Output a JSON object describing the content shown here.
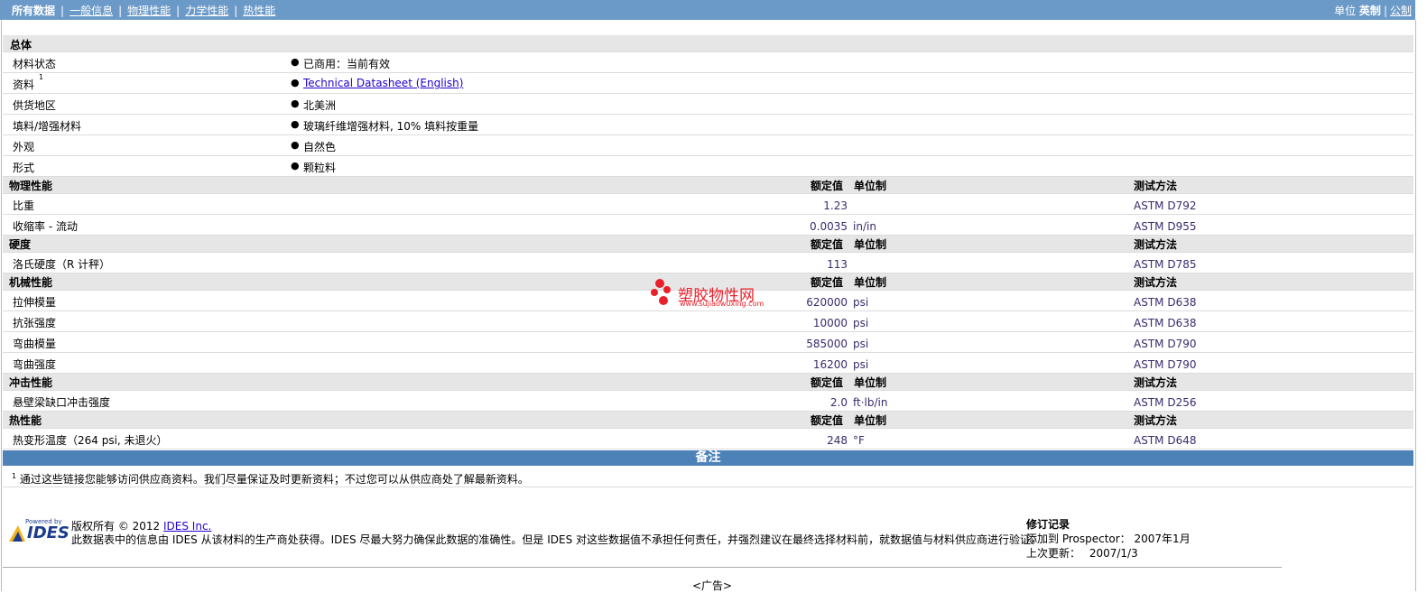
{
  "nav": {
    "items": [
      "所有数据",
      "一般信息",
      "物理性能",
      "力学性能",
      "热性能"
    ],
    "unit_label": "单位",
    "unit_english": "英制",
    "unit_metric": "公制"
  },
  "col_headers": {
    "value": "额定值",
    "unit": "单位制",
    "method": "测试方法"
  },
  "general": {
    "title": "总体",
    "rows": [
      {
        "label": "材料状态",
        "value": "已商用：当前有效"
      },
      {
        "label": "资料",
        "sup": "1",
        "value": "Technical Datasheet (English)"
      },
      {
        "label": "供货地区",
        "value": "北美洲"
      },
      {
        "label": "填料/增强材料",
        "value": "玻璃纤维增强材料, 10% 填料按重量"
      },
      {
        "label": "外观",
        "value": "自然色"
      },
      {
        "label": "形式",
        "value": "颗粒料"
      }
    ]
  },
  "sections": [
    {
      "title": "物理性能",
      "rows": [
        {
          "label": "比重",
          "value": "1.23",
          "unit": "",
          "method": "ASTM D792"
        },
        {
          "label": "收缩率  - 流动",
          "value": "0.0035",
          "unit": "in/in",
          "method": "ASTM D955"
        }
      ]
    },
    {
      "title": "硬度",
      "rows": [
        {
          "label": "洛氏硬度（R 计秤）",
          "value": "113",
          "unit": "",
          "method": "ASTM D785"
        }
      ]
    },
    {
      "title": "机械性能",
      "rows": [
        {
          "label": "拉伸模量",
          "value": "620000",
          "unit": "psi",
          "method": "ASTM D638"
        },
        {
          "label": "抗张强度",
          "value": "10000",
          "unit": "psi",
          "method": "ASTM D638"
        },
        {
          "label": "弯曲模量",
          "value": "585000",
          "unit": "psi",
          "method": "ASTM D790"
        },
        {
          "label": "弯曲强度",
          "value": "16200",
          "unit": "psi",
          "method": "ASTM D790"
        }
      ]
    },
    {
      "title": "冲击性能",
      "rows": [
        {
          "label": "悬壁梁缺口冲击强度",
          "value": "2.0",
          "unit": "ft·lb/in",
          "method": "ASTM D256"
        }
      ]
    },
    {
      "title": "热性能",
      "rows": [
        {
          "label": "热变形温度（264 psi, 未退火）",
          "value": "248",
          "unit": "°F",
          "method": "ASTM D648"
        }
      ]
    }
  ],
  "notes": {
    "title": "备注",
    "sup": "1",
    "text": "通过这些链接您能够访问供应商资料。我们尽量保证及时更新资料；不过您可以从供应商处了解最新资料。"
  },
  "watermark": {
    "text": "塑胶物性网",
    "url_text": "www.sujiaowuxing.com"
  },
  "footer": {
    "powered_by": "Powered by",
    "logo_text": "IDES",
    "copyright": "版权所有 © 2012",
    "copyright_link": "IDES Inc.",
    "disclaimer": "此数据表中的信息由 IDES 从该材料的生产商处获得。IDES 尽最大努力确保此数据的准确性。但是 IDES 对这些数据值不承担任何责任，并强烈建议在最终选择材料前，就数据值与材料供应商进行验证。",
    "revision_title": "修订记录",
    "added_label": "添加到 Prospector：",
    "added_value": "2007年1月",
    "updated_label": "上次更新：",
    "updated_value": "2007/1/3",
    "ad": "<广告>"
  }
}
